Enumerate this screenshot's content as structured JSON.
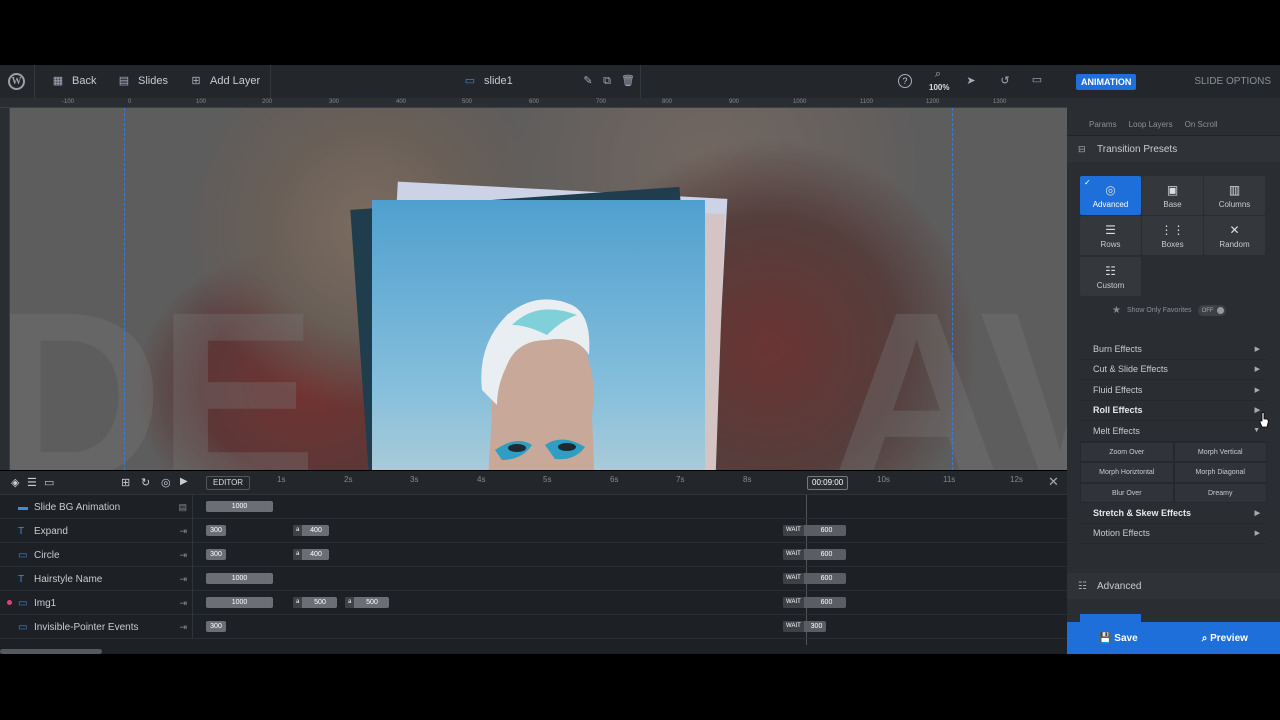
{
  "topbar": {
    "back": "Back",
    "slides": "Slides",
    "add_layer": "Add Layer",
    "slide_name": "slide1",
    "zoom": "100%"
  },
  "ruler": {
    "ticks": [
      "-100",
      "0",
      "100",
      "200",
      "300",
      "400",
      "500",
      "600",
      "700",
      "800",
      "900",
      "1000",
      "1100",
      "1200",
      "1300"
    ]
  },
  "timeline": {
    "editor_label": "EDITOR",
    "time_ticks": [
      "1s",
      "2s",
      "3s",
      "4s",
      "5s",
      "6s",
      "7s",
      "8s",
      "10s",
      "11s",
      "12s"
    ],
    "current_time": "00:09:00",
    "rows": [
      {
        "name": "Slide BG Animation",
        "bars": [
          {
            "label": "1000"
          }
        ]
      },
      {
        "name": "Expand",
        "bars": [
          {
            "label": "300"
          },
          {
            "tag": "a",
            "label": "400"
          },
          {
            "tag": "WAIT",
            "label": "600"
          }
        ]
      },
      {
        "name": "Circle",
        "bars": [
          {
            "label": "300"
          },
          {
            "tag": "a",
            "label": "400"
          },
          {
            "tag": "WAIT",
            "label": "600"
          }
        ]
      },
      {
        "name": "Hairstyle Name",
        "bars": [
          {
            "label": "1000"
          },
          {
            "tag": "WAIT",
            "label": "600"
          }
        ]
      },
      {
        "name": "Img1",
        "bars": [
          {
            "label": "1000"
          },
          {
            "tag": "a",
            "label": "500"
          },
          {
            "tag": "a",
            "label": "500"
          },
          {
            "tag": "WAIT",
            "label": "600"
          }
        ]
      },
      {
        "name": "Invisible-Pointer Events",
        "bars": [
          {
            "label": "300"
          },
          {
            "tag": "WAIT",
            "label": "300"
          }
        ]
      }
    ]
  },
  "panel": {
    "tab_active": "ANIMATION",
    "tab_other": "SLIDE OPTIONS",
    "subtabs": [
      "Params",
      "Loop Layers",
      "On Scroll"
    ],
    "transition_presets": "Transition Presets",
    "presets": [
      "Advanced",
      "Base",
      "Columns",
      "Rows",
      "Boxes",
      "Random",
      "Custom"
    ],
    "show_favorites": "Show Only Favorites",
    "toggle": "OFF",
    "effects_top": [
      "Burn Effects",
      "Cut & Slide Effects",
      "Fluid Effects",
      "Roll Effects",
      "Melt Effects"
    ],
    "melt_sub": [
      "Zoom Over",
      "Morph Vertical",
      "Morph Horiztontal",
      "Morph Diagonal",
      "Blur Over",
      "Dreamy"
    ],
    "effects_bottom": [
      "Stretch & Skew Effects",
      "Motion Effects"
    ],
    "advanced": "Advanced",
    "save": "Save",
    "preview": "Preview"
  },
  "colors": {
    "accent": "#1e6fd9",
    "panel": "#2a2e33",
    "topbar": "#23272c"
  }
}
